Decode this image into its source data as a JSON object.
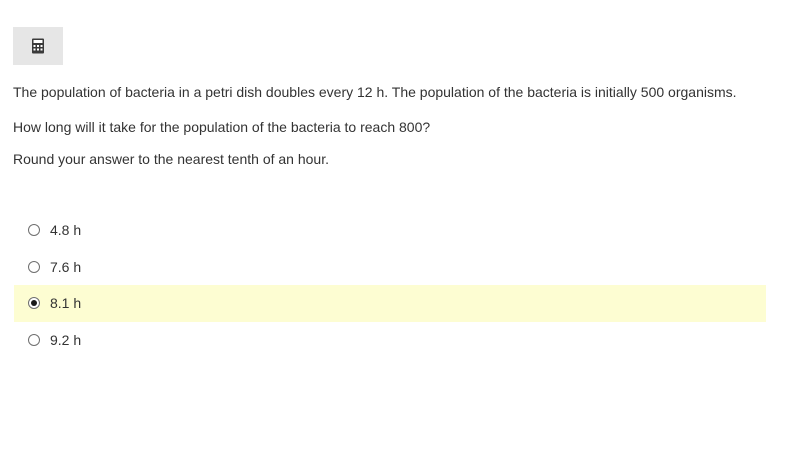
{
  "toolbar": {
    "calculator_icon": "calculator-icon"
  },
  "question": {
    "line1": "The population of bacteria in a petri dish doubles every 12 h. The population of the bacteria is initially 500 organisms.",
    "line2": "How long will it take for the population of the bacteria to reach 800?",
    "line3": "Round your answer to the nearest tenth of an hour."
  },
  "options": [
    {
      "label": "4.8 h",
      "selected": false
    },
    {
      "label": "7.6 h",
      "selected": false
    },
    {
      "label": "8.1 h",
      "selected": true
    },
    {
      "label": "9.2 h",
      "selected": false
    }
  ],
  "colors": {
    "selected_highlight": "#fdfdd2",
    "calculator_button_bg": "#e6e6e6"
  }
}
